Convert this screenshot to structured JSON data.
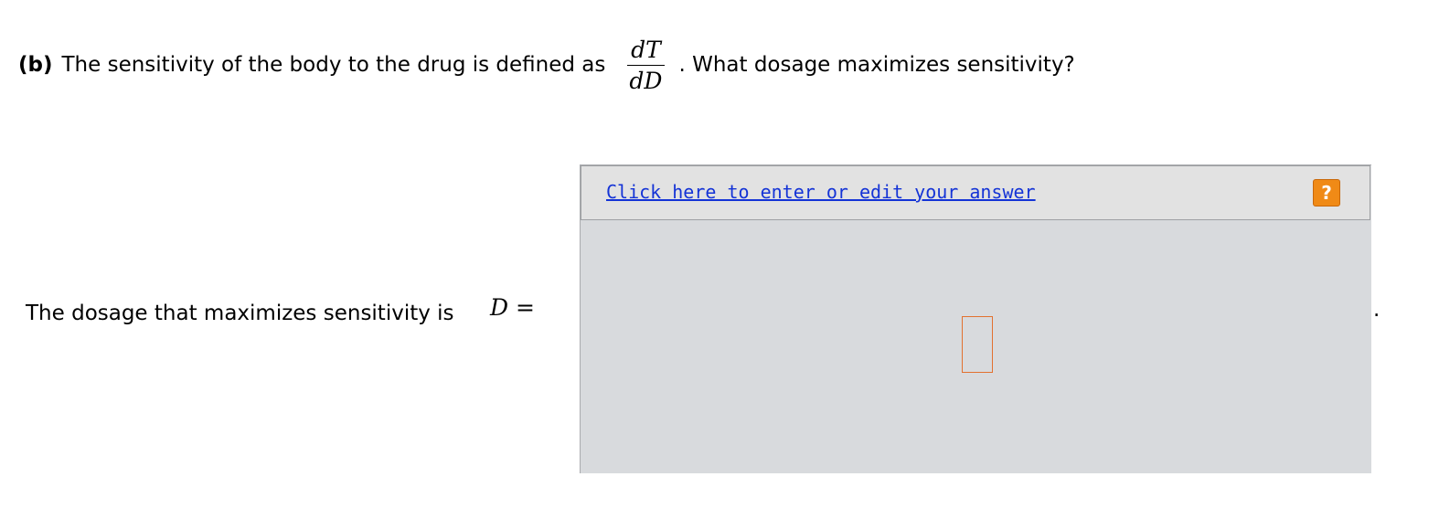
{
  "question": {
    "part_label": "(b)",
    "text_before": "The sensitivity of the body to the drug is defined as",
    "fraction": {
      "numerator": "dT",
      "denominator": "dD"
    },
    "text_after": ". What dosage maximizes sensitivity?"
  },
  "answer": {
    "prompt": "The dosage that maximizes sensitivity is",
    "variable": "D",
    "equals": "=",
    "trailing": "."
  },
  "answer_editor": {
    "link_text": "Click here to enter or edit your answer",
    "help_label": "?",
    "colors": {
      "panel": "#d8dadd",
      "header": "#e2e2e2",
      "link": "#1433d6",
      "help_button": "#f08a16",
      "input_border": "#e2712f"
    }
  }
}
